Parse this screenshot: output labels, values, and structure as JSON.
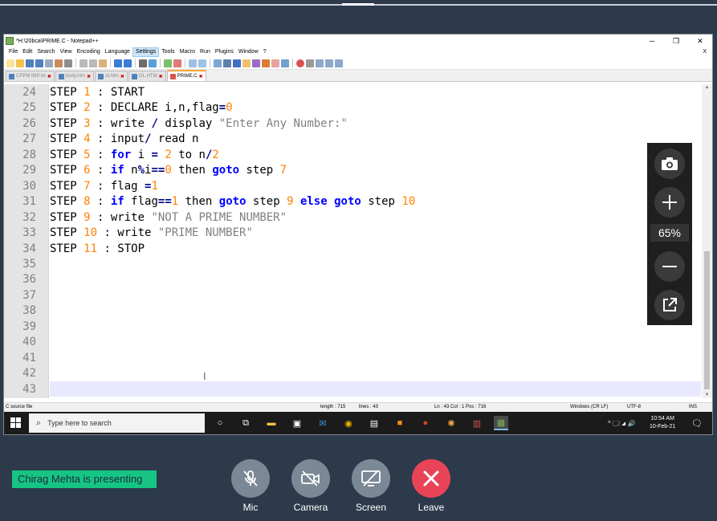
{
  "window": {
    "title": "*H:\\20bca\\PRIME.C - Notepad++",
    "minimize": "─",
    "maximize": "❐",
    "close": "✕"
  },
  "menu": [
    "File",
    "Edit",
    "Search",
    "View",
    "Encoding",
    "Language",
    "Settings",
    "Tools",
    "Macro",
    "Run",
    "Plugins",
    "Window",
    "?"
  ],
  "menu_active": "Settings",
  "menu_close": "X",
  "tabs": [
    {
      "label": "CPPM IMP.txt"
    },
    {
      "label": "body.htm"
    },
    {
      "label": "dt.htm"
    },
    {
      "label": "OL.HTM"
    },
    {
      "label": "PRIME.C"
    }
  ],
  "active_tab": "PRIME.C",
  "editor": {
    "line_numbers": [
      "24",
      "25",
      "26",
      "27",
      "28",
      "29",
      "30",
      "31",
      "32",
      "33",
      "34",
      "35",
      "36",
      "37",
      "38",
      "39",
      "40",
      "41",
      "42",
      "43"
    ],
    "current_line": "43"
  },
  "status": {
    "file_type": "C source file",
    "length": "length : 715",
    "lines": "lines : 43",
    "position": "Ln : 43    Col : 1    Pos : 716",
    "eol": "Windows (CR LF)",
    "encoding": "UTF-8",
    "mode": "INS"
  },
  "taskbar": {
    "search_placeholder": "Type here to search",
    "tray_icons": "^ 🗔 ◢ 🔊",
    "time": "10:54 AM",
    "date": "10-Feb-21"
  },
  "zoom": {
    "level": "65%"
  },
  "meeting": {
    "presenter_text": "Chirag Mehta is presenting",
    "controls": {
      "mic": "Mic",
      "camera": "Camera",
      "screen": "Screen",
      "leave": "Leave"
    }
  },
  "colors": {
    "presenter_bg": "#16c584",
    "leave": "#e94358",
    "control_bg": "#7b8896",
    "meeting_bg": "#2c3a4b"
  },
  "icons": [
    "camera-icon",
    "zoom-in-icon",
    "zoom-out-icon",
    "popout-icon",
    "mic-off-icon",
    "camera-off-icon",
    "screen-share-off-icon",
    "close-icon",
    "windows-start-icon",
    "search-icon"
  ]
}
